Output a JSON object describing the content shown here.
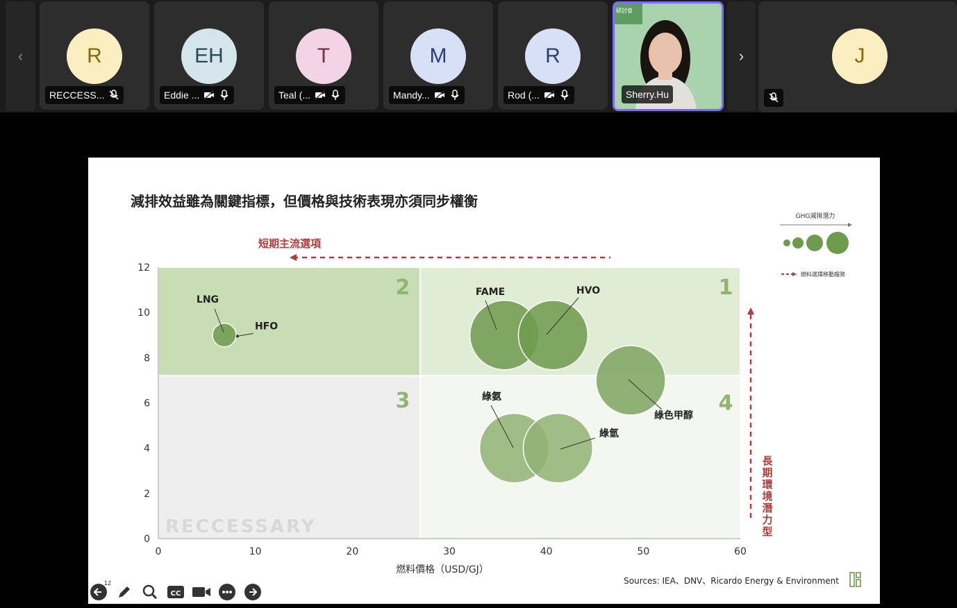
{
  "participants": [
    {
      "initials": "R",
      "name": "RECCESS...",
      "bg": "#fbeec1",
      "fg": "#8a6a00",
      "mic": "muted"
    },
    {
      "initials": "EH",
      "name": "Eddie ...",
      "bg": "#d4e6ec",
      "fg": "#254a57",
      "mic": "on"
    },
    {
      "initials": "T",
      "name": "Teal (...",
      "bg": "#f2d4e6",
      "fg": "#7a2a52",
      "mic": "on"
    },
    {
      "initials": "M",
      "name": "Mandy...",
      "bg": "#d8e0f5",
      "fg": "#2a3f7a",
      "mic": "on"
    },
    {
      "initials": "R",
      "name": "Rod (...",
      "bg": "#d8e0f5",
      "fg": "#2a3f7a",
      "mic": "on"
    }
  ],
  "active_speaker": {
    "name": "Sherry.Hu",
    "banner": "研討會"
  },
  "last_participant": {
    "initials": "J",
    "bg": "#fbeec1",
    "fg": "#8a6a00"
  },
  "slide": {
    "title": "減排效益雖為關鍵指標，但價格與技術表現亦須同步權衡",
    "short_term_label": "短期主流選項",
    "long_term_label": "長期環境潛力型",
    "legend_title": "GHG減排潛力",
    "legend_trend": "燃料選擇移動趨勢",
    "watermark": "RECCESSARY",
    "sources": "Sources: IEA、DNV、Ricardo Energy & Environment",
    "page_badge": "12"
  },
  "chart_data": {
    "type": "scatter",
    "xlabel": "燃料價格（USD/GJ）",
    "xlim": [
      0,
      60
    ],
    "ylim": [
      0,
      12
    ],
    "xticks": [
      0,
      10,
      20,
      30,
      40,
      50,
      60
    ],
    "yticks": [
      0,
      2,
      4,
      6,
      8,
      10,
      12
    ],
    "quadrants": [
      {
        "id": "1",
        "label": "1",
        "x": [
          27,
          60
        ],
        "y": [
          7.2,
          12
        ],
        "color": "#e0ecd3"
      },
      {
        "id": "2",
        "label": "2",
        "x": [
          0,
          27
        ],
        "y": [
          7.2,
          12
        ],
        "color": "#c9ddb5"
      },
      {
        "id": "3",
        "label": "3",
        "x": [
          0,
          27
        ],
        "y": [
          0,
          7.2
        ],
        "color": "#eeeeee"
      },
      {
        "id": "4",
        "label": "4",
        "x": [
          27,
          60
        ],
        "y": [
          0,
          7.2
        ],
        "color": "#f3f7ef"
      }
    ],
    "points": [
      {
        "name": "LNG",
        "x": 6.8,
        "y": 9.0,
        "size": 1,
        "color": "#6d9b4d"
      },
      {
        "name": "FAME",
        "x": 35.7,
        "y": 9.0,
        "size": 3,
        "color": "#6d9b4d"
      },
      {
        "name": "HVO",
        "x": 40.7,
        "y": 9.0,
        "size": 3,
        "color": "#6d9b4d"
      },
      {
        "name": "綠色甲醇",
        "x": 48.7,
        "y": 7.0,
        "size": 3,
        "color": "#7ea560"
      },
      {
        "name": "綠氨",
        "x": 36.7,
        "y": 4.0,
        "size": 3,
        "color": "#90b373"
      },
      {
        "name": "綠氫",
        "x": 41.2,
        "y": 4.0,
        "size": 3,
        "color": "#90b373"
      }
    ],
    "annotations": [
      {
        "name": "HFO",
        "x": 7.8,
        "y": 8.95
      }
    ]
  }
}
